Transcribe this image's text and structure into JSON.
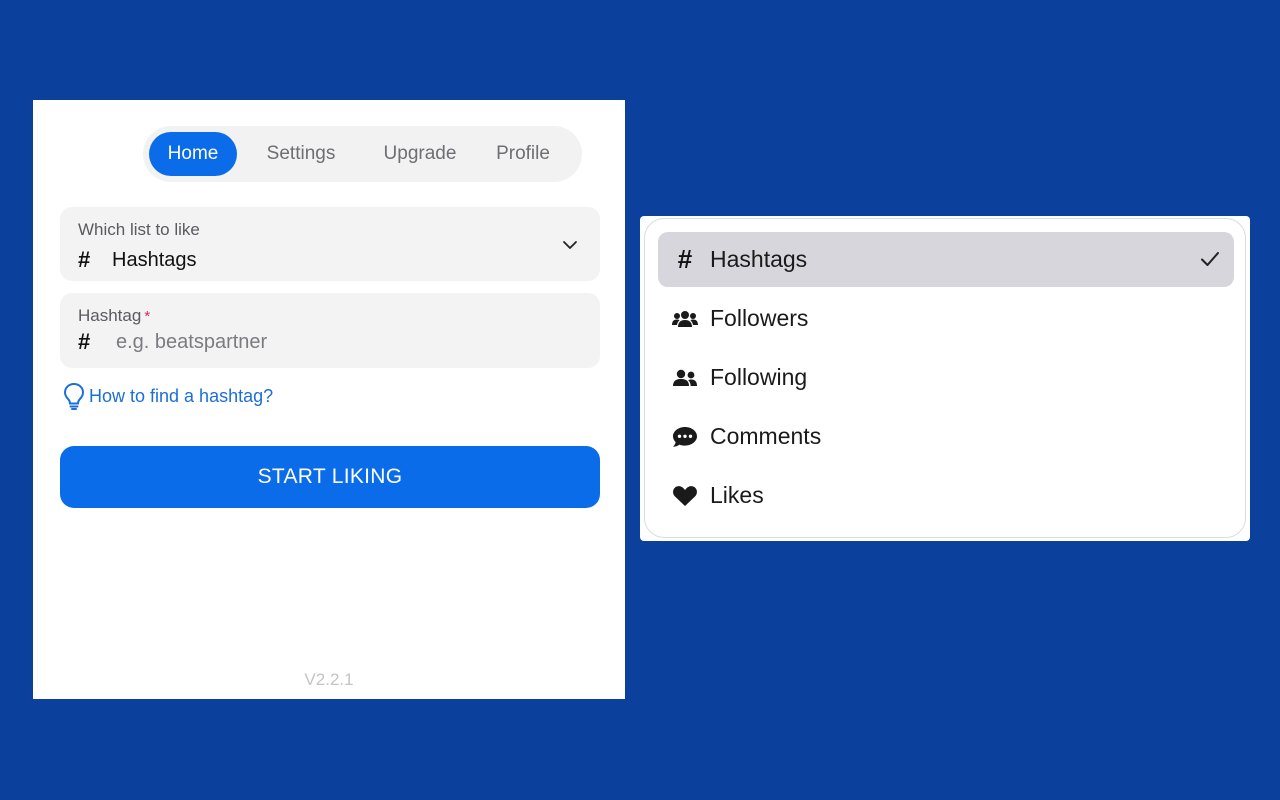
{
  "tabs": [
    {
      "label": "Home",
      "active": true
    },
    {
      "label": "Settings",
      "active": false
    },
    {
      "label": "Upgrade",
      "active": false
    },
    {
      "label": "Profile",
      "active": false
    }
  ],
  "list_field": {
    "label": "Which list to like",
    "value": "Hashtags",
    "icon": "hash-icon"
  },
  "hashtag_field": {
    "label": "Hashtag",
    "required_mark": "*",
    "value": "",
    "placeholder": "e.g. beatspartner",
    "icon": "hash-icon"
  },
  "help_link": {
    "label": "How to find a hashtag?",
    "icon": "lightbulb-icon"
  },
  "start_button": {
    "label": "START LIKING"
  },
  "version": "V2.2.1",
  "dropdown": {
    "selected": "Hashtags",
    "options": [
      {
        "label": "Hashtags",
        "icon": "hash-icon",
        "selected": true
      },
      {
        "label": "Followers",
        "icon": "users-group-icon",
        "selected": false
      },
      {
        "label": "Following",
        "icon": "user-friends-icon",
        "selected": false
      },
      {
        "label": "Comments",
        "icon": "comment-dots-icon",
        "selected": false
      },
      {
        "label": "Likes",
        "icon": "heart-icon",
        "selected": false
      }
    ]
  },
  "colors": {
    "background": "#0b419d",
    "accent": "#0a6ce8",
    "link": "#1a6fd8",
    "field_bg": "#f3f3f4",
    "selected_option_bg": "#d6d6dc",
    "required": "#e0245e"
  }
}
